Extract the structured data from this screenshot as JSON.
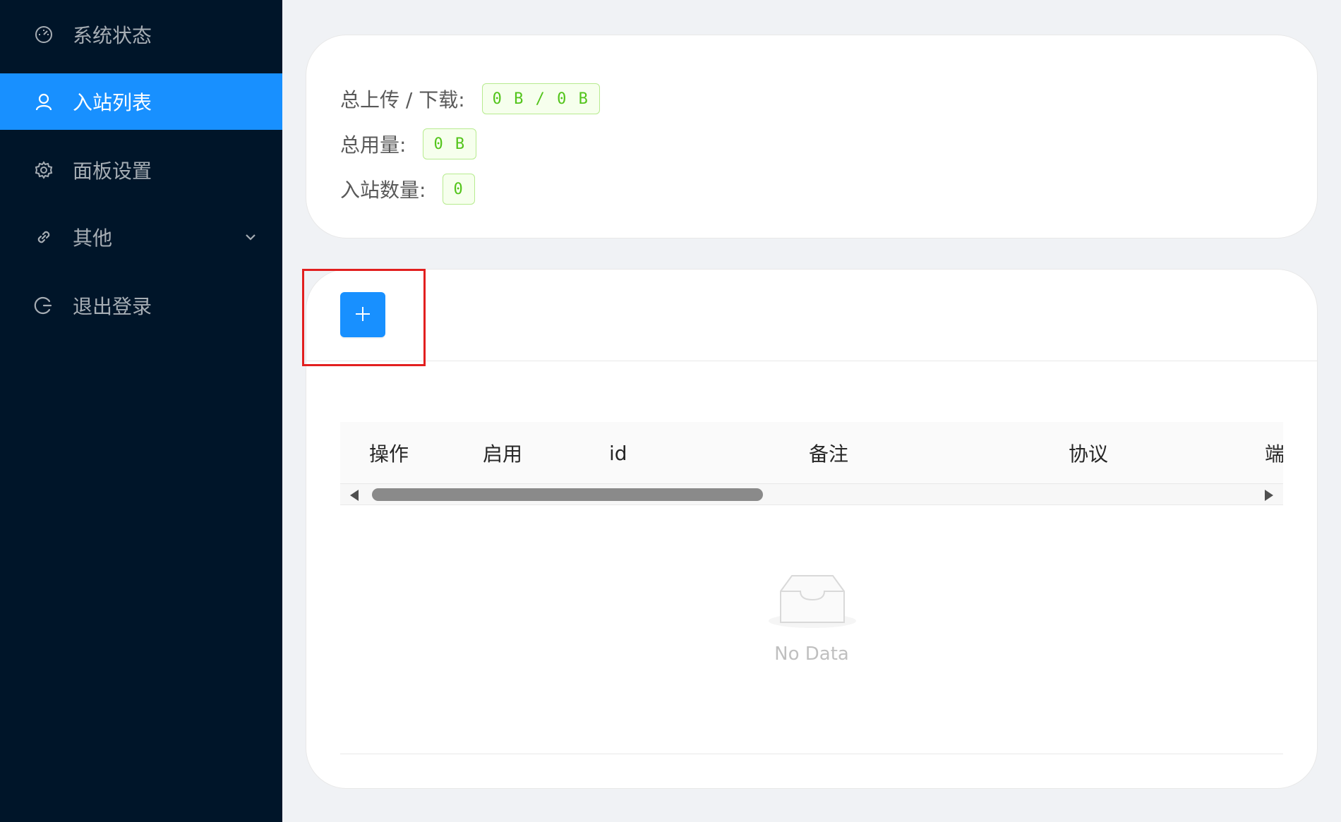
{
  "sidebar": {
    "items": [
      {
        "label": "系统状态",
        "icon": "dashboard-icon",
        "active": false
      },
      {
        "label": "入站列表",
        "icon": "user-icon",
        "active": true
      },
      {
        "label": "面板设置",
        "icon": "gear-icon",
        "active": false
      },
      {
        "label": "其他",
        "icon": "link-icon",
        "active": false,
        "submenu_icon": "chevron-down-icon"
      },
      {
        "label": "退出登录",
        "icon": "logout-icon",
        "active": false
      }
    ]
  },
  "stats": {
    "upload_download_label": "总上传 / 下载:",
    "upload_download_value": "0 B / 0 B",
    "total_usage_label": "总用量:",
    "total_usage_value": "0 B",
    "inbound_count_label": "入站数量:",
    "inbound_count_value": "0"
  },
  "toolbar": {
    "add_icon": "plus-icon"
  },
  "table": {
    "columns": [
      "操作",
      "启用",
      "id",
      "备注",
      "协议",
      "端"
    ],
    "empty_text": "No Data"
  },
  "colors": {
    "sidebar_bg": "#001529",
    "accent": "#1890ff",
    "tag_green": "#52c41a",
    "highlight": "#e21f1f"
  }
}
